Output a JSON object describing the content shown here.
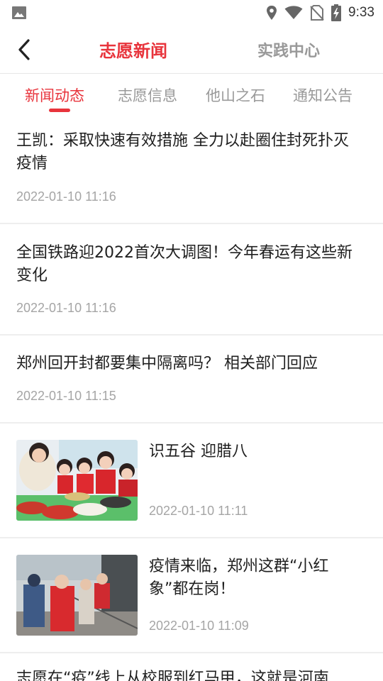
{
  "status_bar": {
    "time": "9:33",
    "icons": [
      "image-icon",
      "location-icon",
      "wifi-icon",
      "no-sim-icon",
      "battery-charging-icon"
    ]
  },
  "header": {
    "back_icon": "chevron-left-icon",
    "tabs": [
      {
        "label": "志愿新闻",
        "active": true
      },
      {
        "label": "实践中心",
        "active": false
      }
    ]
  },
  "sub_tabs": [
    {
      "label": "新闻动态",
      "active": true
    },
    {
      "label": "志愿信息",
      "active": false
    },
    {
      "label": "他山之石",
      "active": false
    },
    {
      "label": "通知公告",
      "active": false
    }
  ],
  "news": [
    {
      "title": "王凯：采取快速有效措施 全力以赴圈住封死扑灭疫情",
      "date": "2022-01-10 11:16",
      "has_image": false
    },
    {
      "title": "全国铁路迎2022首次大调图！今年春运有这些新变化",
      "date": "2022-01-10 11:16",
      "has_image": false
    },
    {
      "title": "郑州回开封都要集中隔离吗？ 相关部门回应",
      "date": "2022-01-10 11:15",
      "has_image": false
    },
    {
      "title": "识五谷 迎腊八",
      "date": "2022-01-10 11:11",
      "has_image": true,
      "image": "children-grains-photo"
    },
    {
      "title": "疫情来临，郑州这群“小红象”都在岗！",
      "date": "2022-01-10 11:09",
      "has_image": true,
      "image": "volunteers-photo"
    },
    {
      "title": "志愿在“疫”线上从校服到红马甲，这就是河南",
      "date": "",
      "has_image": false
    }
  ],
  "colors": {
    "accent": "#e8343c",
    "inactive": "#999999",
    "date": "#a5a5a5",
    "divider": "#eeeeee"
  }
}
